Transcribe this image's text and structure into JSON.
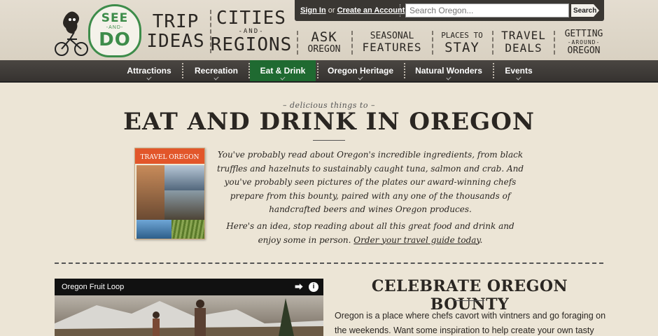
{
  "logo": {
    "line1": "SEE",
    "line2": "-AND-",
    "line3": "DO"
  },
  "primary_nav": [
    {
      "l1": "TRIP",
      "mid": "",
      "l2": "IDEAS"
    },
    {
      "l1": "CITIES",
      "mid": "-AND-",
      "l2": "REGIONS"
    }
  ],
  "topbar": {
    "sign_in": "Sign In",
    "or_text": " or ",
    "create_account": "Create an Account",
    "search_placeholder": "Search Oregon...",
    "search_button": "Search"
  },
  "secondary_nav": [
    {
      "s1": "ASK",
      "s2": "OREGON"
    },
    {
      "s1": "SEASONAL",
      "s2": "FEATURES"
    },
    {
      "s1": "PLACES TO",
      "s2": "STAY"
    },
    {
      "s1": "TRAVEL",
      "s2": "DEALS"
    },
    {
      "s1": "GETTING",
      "mid": "-AROUND-",
      "s2": "OREGON"
    }
  ],
  "subnav": {
    "items": [
      "Attractions",
      "Recreation",
      "Eat & Drink",
      "Oregon Heritage",
      "Natural Wonders",
      "Events"
    ],
    "active": "Eat & Drink"
  },
  "main": {
    "kicker": "– delicious things to –",
    "title": "EAT AND DRINK IN OREGON",
    "intro_p1": "You've probably read about Oregon's incredible ingredients, from black truffles and hazelnuts to sustainably caught tuna, salmon and crab. And you've probably seen pictures of the plates our award-winning chefs prepare from this bounty, paired with any one of the thousands of handcrafted beers and wines Oregon produces.",
    "intro_p2": "Here's an idea, stop reading about all this great food and drink and enjoy some in person. ",
    "intro_link": "Order your travel guide today",
    "intro_end": "."
  },
  "guide_cover": {
    "title": "TRAVEL OREGON"
  },
  "video": {
    "title": "Oregon Fruit Loop"
  },
  "bounty": {
    "title": "CELEBRATE OREGON BOUNTY",
    "text": "Oregon is a place where chefs cavort with vintners and go foraging on the weekends. Want some inspiration to help create your own tasty"
  },
  "colors": {
    "active_tab": "#1f6a31",
    "logo_green": "#3d8c4a",
    "cover_orange": "#e2562a"
  }
}
